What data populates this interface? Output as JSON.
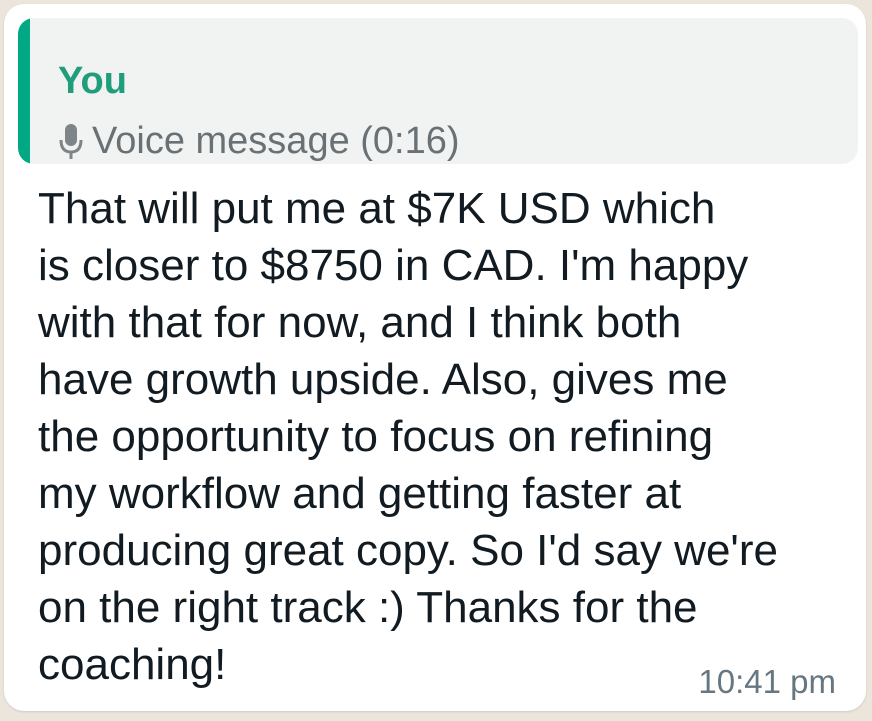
{
  "quoted_message": {
    "author": "You",
    "icon": "microphone-icon",
    "label": "Voice message (0:16)"
  },
  "message": {
    "lines": [
      "That will put me at $7K USD which",
      "is closer to $8750 in CAD. I'm happy",
      "with that for now, and I think both",
      "have growth upside. Also, gives me",
      "the opportunity to focus on refining",
      "my workflow and getting faster at",
      "producing great copy. So I'd say we're",
      "on the right track :) Thanks for the",
      "coaching!"
    ],
    "timestamp": "10:41 pm"
  },
  "colors": {
    "accent": "#00a884",
    "author": "#1f9d7c",
    "bubble": "#ffffff",
    "quote_background": "#f1f3f2",
    "text": "#111b21",
    "meta": "#667781"
  }
}
